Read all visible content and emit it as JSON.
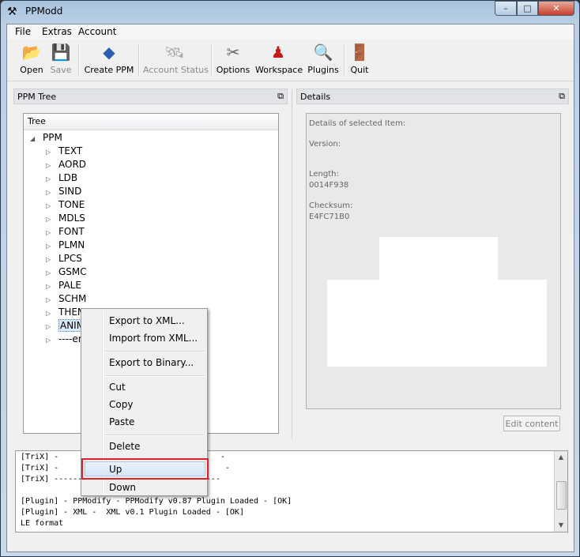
{
  "window": {
    "title": "PPModd",
    "icon": "tools-icon",
    "min": "–",
    "max": "□",
    "close": "✕"
  },
  "menubar": [
    "File",
    "Extras",
    "Account"
  ],
  "toolbar": {
    "open": "Open",
    "save": "Save",
    "create_ppm": "Create PPM",
    "account_status": "Account Status",
    "options": "Options",
    "workspace": "Workspace",
    "plugins": "Plugins",
    "quit": "Quit"
  },
  "tree_panel": {
    "title": "PPM Tree",
    "column_header": "Tree",
    "root": "PPM",
    "children": [
      "TEXT",
      "AORD",
      "LDB",
      "SIND",
      "TONE",
      "MDLS",
      "FONT",
      "PLMN",
      "LPCS",
      "GSMC",
      "PALE",
      "SCHM",
      "THEM",
      "ANIM",
      "----er"
    ]
  },
  "details_panel": {
    "title": "Details",
    "heading": "Details of selected Item:",
    "version_label": "Version:",
    "length_label": "Length:",
    "length_value": "0014F938",
    "checksum_label": "Checksum:",
    "checksum_value": "E4FC71B0",
    "edit_button": "Edit content"
  },
  "log": [
    "[TriX] -                                  -",
    "[TriX] -                          tisha    -",
    "[TriX] -----------------------------------",
    "",
    "[Plugin] - PPModify - PPModify v0.87 Plugin Loaded - [OK]",
    "[Plugin] - XML -  XML v0.1 Plugin Loaded - [OK]",
    "LE format"
  ],
  "context_menu": {
    "export_xml": "Export to XML...",
    "import_xml": "Import from XML...",
    "export_binary": "Export to Binary...",
    "cut": "Cut",
    "copy": "Copy",
    "paste": "Paste",
    "delete": "Delete",
    "up": "Up",
    "down": "Down",
    "highlight_color": "#e0202a"
  }
}
